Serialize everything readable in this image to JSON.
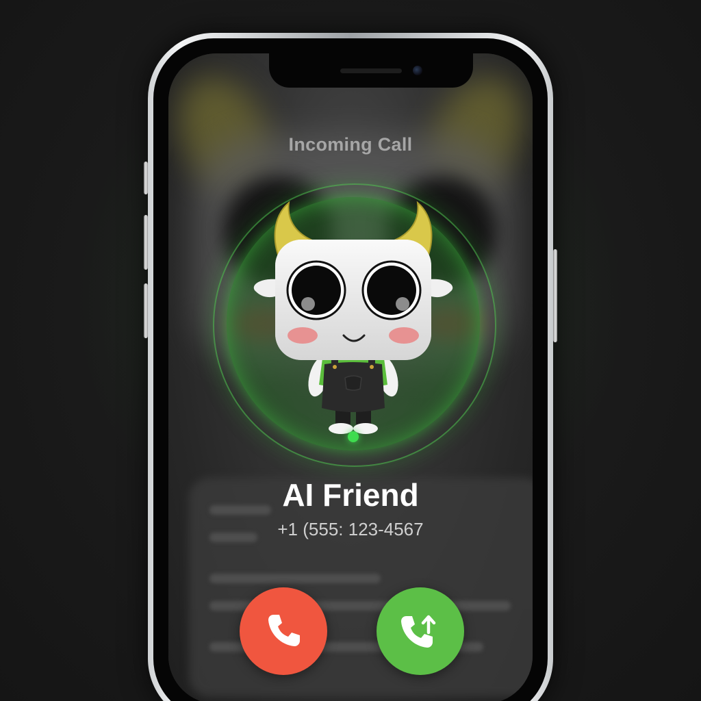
{
  "call": {
    "status_label": "Incoming Call",
    "caller_name": "AI Friend",
    "caller_number": "+1 (555: 123-4567"
  },
  "icons": {
    "decline": "phone-icon",
    "accept": "phone-incoming-icon",
    "avatar": "robot-avatar"
  },
  "colors": {
    "decline": "#f0563f",
    "accept": "#5cbf47",
    "ring_glow": "#3fdc4f"
  }
}
